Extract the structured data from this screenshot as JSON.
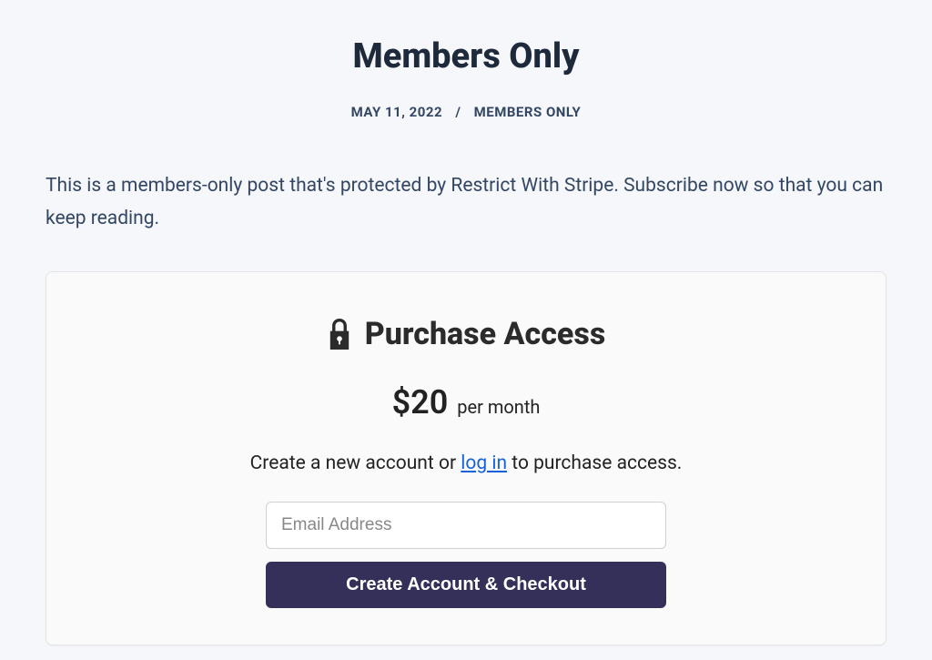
{
  "page": {
    "title": "Members Only",
    "date": "MAY 11, 2022",
    "category": "MEMBERS ONLY",
    "separator": "/"
  },
  "post": {
    "body": "This is a members-only post that's protected by Restrict With Stripe. Subscribe now so that you can keep reading."
  },
  "access": {
    "title": "Purchase Access",
    "price": "$20",
    "period": "per month",
    "prompt_before": "Create a new account or ",
    "login_text": "log in",
    "prompt_after": " to purchase access.",
    "email_placeholder": "Email Address",
    "button_label": "Create Account & Checkout"
  }
}
